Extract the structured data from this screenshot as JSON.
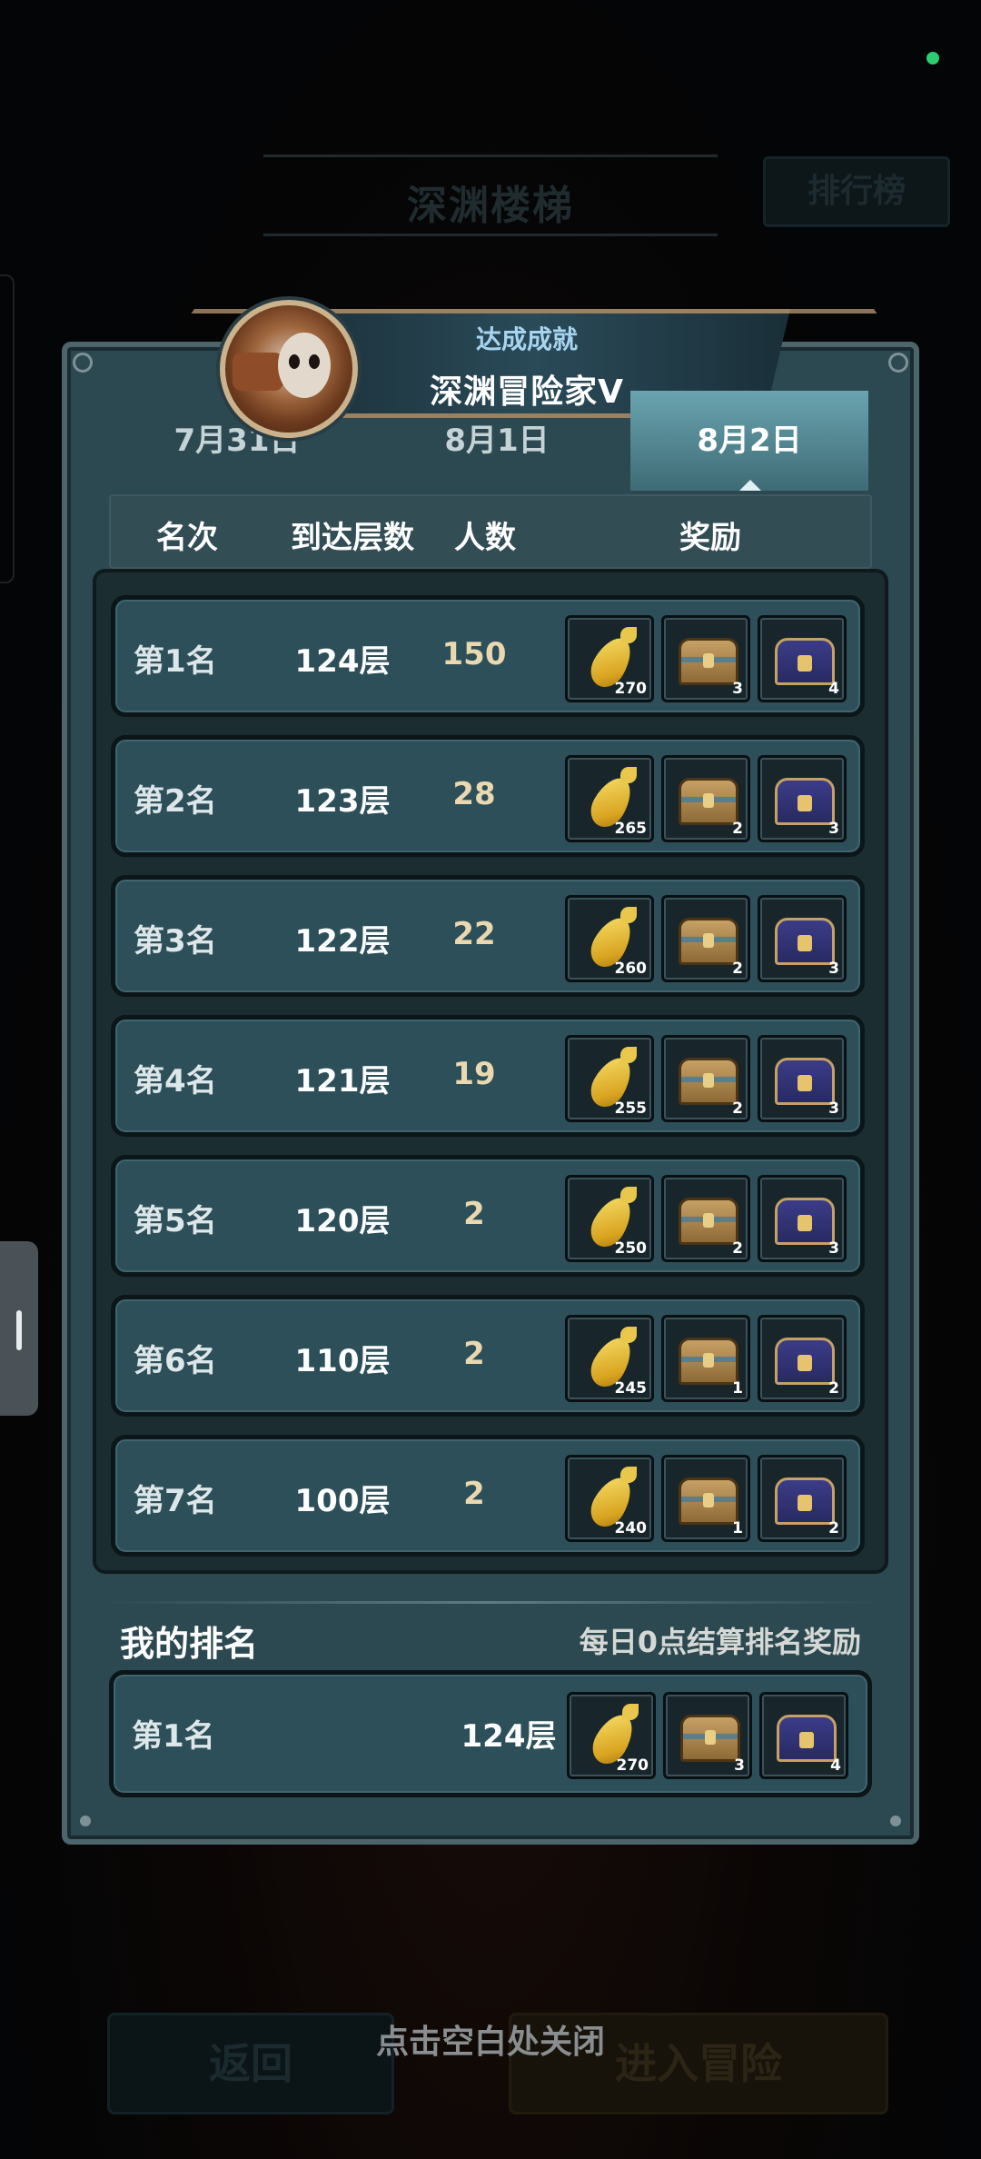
{
  "background": {
    "title": "深渊楼梯",
    "rank_button": "排行榜",
    "back_button": "返回",
    "enter_button": "进入冒险"
  },
  "achievement": {
    "subtitle": "达成成就",
    "title": "深渊冒险家V"
  },
  "tabs": [
    {
      "label": "7月31日",
      "active": false
    },
    {
      "label": "8月1日",
      "active": false
    },
    {
      "label": "8月2日",
      "active": true
    }
  ],
  "table_header": {
    "rank": "名次",
    "floor": "到达层数",
    "count": "人数",
    "reward": "奖励"
  },
  "rows": [
    {
      "rank": "第1名",
      "floor": "124层",
      "count": "150",
      "rewards": [
        "270",
        "3",
        "4"
      ]
    },
    {
      "rank": "第2名",
      "floor": "123层",
      "count": "28",
      "rewards": [
        "265",
        "2",
        "3"
      ]
    },
    {
      "rank": "第3名",
      "floor": "122层",
      "count": "22",
      "rewards": [
        "260",
        "2",
        "3"
      ]
    },
    {
      "rank": "第4名",
      "floor": "121层",
      "count": "19",
      "rewards": [
        "255",
        "2",
        "3"
      ]
    },
    {
      "rank": "第5名",
      "floor": "120层",
      "count": "2",
      "rewards": [
        "250",
        "2",
        "3"
      ]
    },
    {
      "rank": "第6名",
      "floor": "110层",
      "count": "2",
      "rewards": [
        "245",
        "1",
        "2"
      ]
    },
    {
      "rank": "第7名",
      "floor": "100层",
      "count": "2",
      "rewards": [
        "240",
        "1",
        "2"
      ]
    }
  ],
  "reward_icons": [
    "carrot-icon",
    "chest-icon",
    "purple-chest-icon"
  ],
  "my_ranking": {
    "title": "我的排名",
    "note": "每日0点结算排名奖励",
    "rank": "第1名",
    "floor": "124层",
    "rewards": [
      "270",
      "3",
      "4"
    ]
  },
  "close_hint": "点击空白处关闭",
  "colors": {
    "panel": "#2c4850",
    "row": "#2d4f59",
    "active_tab": "#6aa4b0",
    "count_text": "#e9d8b0",
    "status_dot": "#2ecc71"
  }
}
